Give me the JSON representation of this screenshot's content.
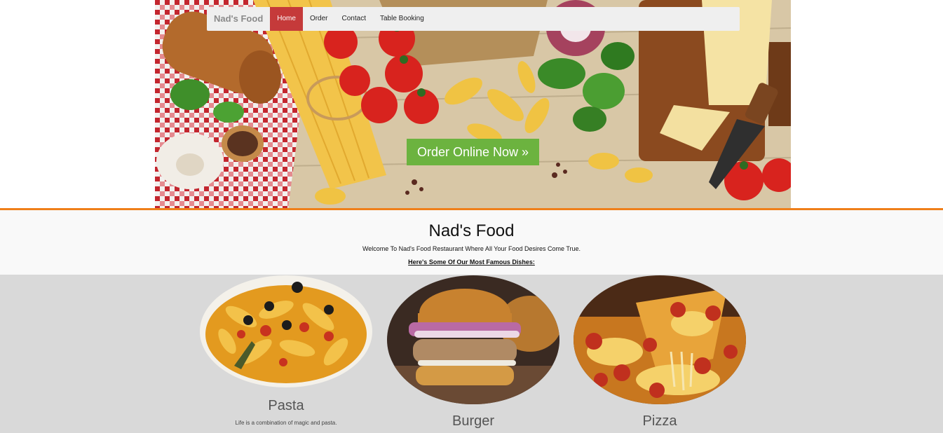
{
  "navbar": {
    "brand": "Nad's Food",
    "items": [
      {
        "label": "Home",
        "active": true
      },
      {
        "label": "Order",
        "active": false
      },
      {
        "label": "Contact",
        "active": false
      },
      {
        "label": "Table Booking",
        "active": false
      }
    ]
  },
  "hero": {
    "cta_label": "Order Online Now »"
  },
  "intro": {
    "title": "Nad's Food",
    "welcome": "Welcome To Nad's Food Restaurant Where All Your Food Desires Come True.",
    "famous_heading": "Here's Some Of Our Most Famous Dishes:"
  },
  "dishes": [
    {
      "name": "Pasta",
      "description": "Life is a combination of magic and pasta."
    },
    {
      "name": "Burger",
      "description": ""
    },
    {
      "name": "Pizza",
      "description": ""
    }
  ],
  "colors": {
    "nav_active": "#c53a3a",
    "cta": "#6cb33f",
    "accent_rule": "#ef7f1a",
    "dishes_bg": "#d9d9d9"
  }
}
